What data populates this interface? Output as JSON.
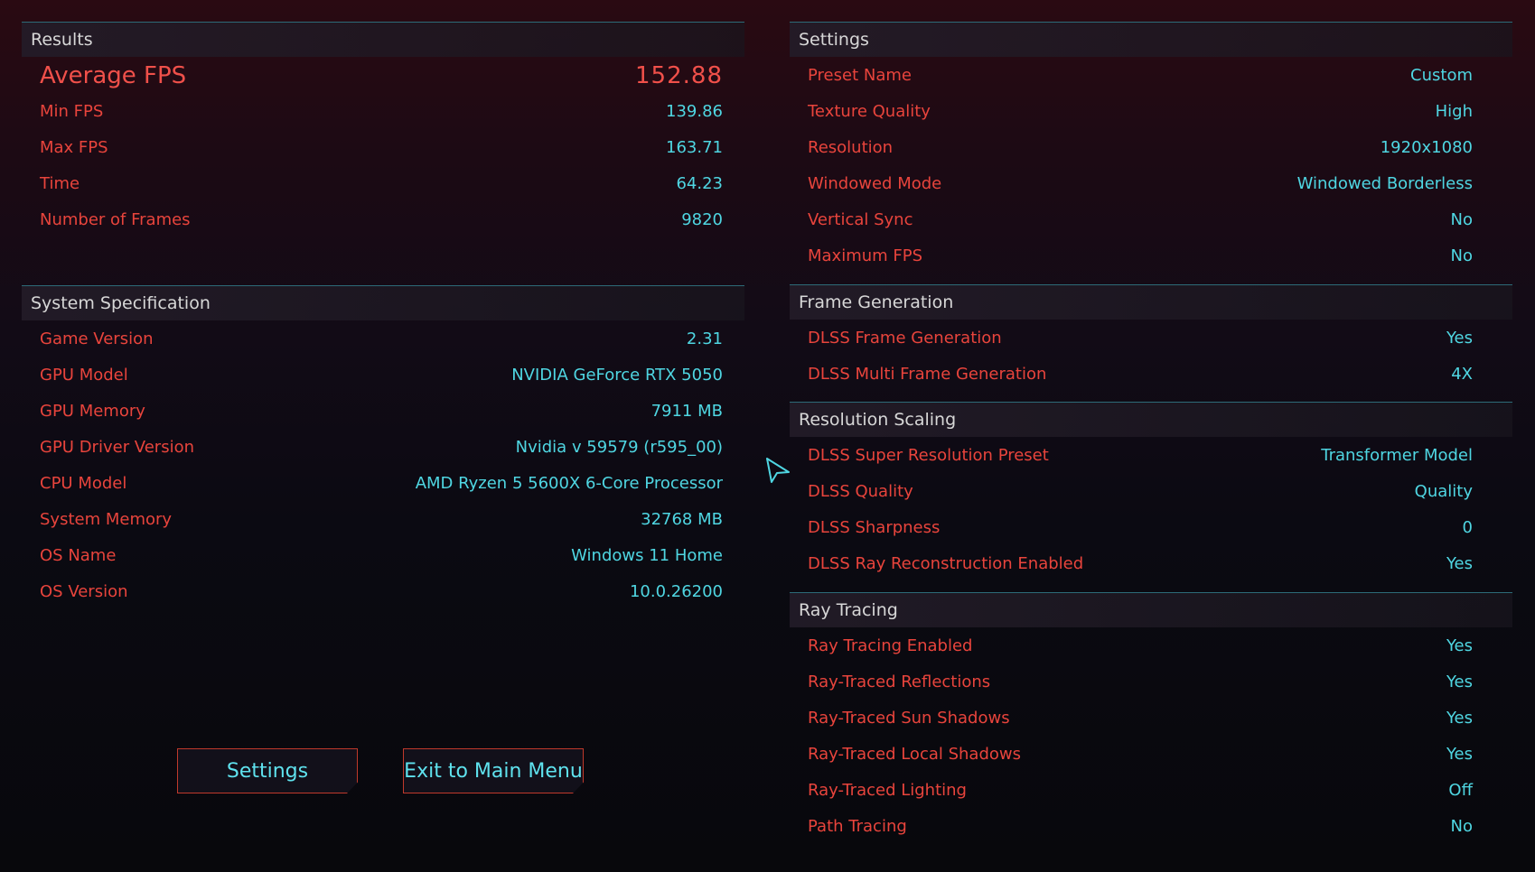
{
  "results": {
    "header": "Results",
    "average": {
      "label": "Average FPS",
      "value": "152.88"
    },
    "rows": [
      {
        "label": "Min FPS",
        "value": "139.86"
      },
      {
        "label": "Max FPS",
        "value": "163.71"
      },
      {
        "label": "Time",
        "value": "64.23"
      },
      {
        "label": "Number of Frames",
        "value": "9820"
      }
    ]
  },
  "system": {
    "header": "System Specification",
    "rows": [
      {
        "label": "Game Version",
        "value": "2.31"
      },
      {
        "label": "GPU Model",
        "value": "NVIDIA GeForce RTX 5050"
      },
      {
        "label": "GPU Memory",
        "value": "7911 MB"
      },
      {
        "label": "GPU Driver Version",
        "value": "Nvidia v 59579 (r595_00)"
      },
      {
        "label": "CPU Model",
        "value": "AMD Ryzen 5 5600X 6-Core Processor"
      },
      {
        "label": "System Memory",
        "value": "32768 MB"
      },
      {
        "label": "OS Name",
        "value": "Windows 11 Home"
      },
      {
        "label": "OS Version",
        "value": "10.0.26200"
      }
    ]
  },
  "buttons": {
    "settings": "Settings",
    "exit": "Exit to Main Menu"
  },
  "settings": {
    "header": "Settings",
    "rows": [
      {
        "label": "Preset Name",
        "value": "Custom"
      },
      {
        "label": "Texture Quality",
        "value": "High"
      },
      {
        "label": "Resolution",
        "value": "1920x1080"
      },
      {
        "label": "Windowed Mode",
        "value": "Windowed Borderless"
      },
      {
        "label": "Vertical Sync",
        "value": "No"
      },
      {
        "label": "Maximum FPS",
        "value": "No"
      }
    ]
  },
  "frame_generation": {
    "header": "Frame Generation",
    "rows": [
      {
        "label": "DLSS Frame Generation",
        "value": "Yes"
      },
      {
        "label": "DLSS Multi Frame Generation",
        "value": "4X"
      }
    ]
  },
  "resolution_scaling": {
    "header": "Resolution Scaling",
    "rows": [
      {
        "label": "DLSS Super Resolution Preset",
        "value": "Transformer Model"
      },
      {
        "label": "DLSS Quality",
        "value": "Quality"
      },
      {
        "label": "DLSS Sharpness",
        "value": "0"
      },
      {
        "label": "DLSS Ray Reconstruction Enabled",
        "value": "Yes"
      }
    ]
  },
  "ray_tracing": {
    "header": "Ray Tracing",
    "rows": [
      {
        "label": "Ray Tracing Enabled",
        "value": "Yes"
      },
      {
        "label": "Ray-Traced Reflections",
        "value": "Yes"
      },
      {
        "label": "Ray-Traced Sun Shadows",
        "value": "Yes"
      },
      {
        "label": "Ray-Traced Local Shadows",
        "value": "Yes"
      },
      {
        "label": "Ray-Traced Lighting",
        "value": "Off"
      },
      {
        "label": "Path Tracing",
        "value": "No"
      }
    ]
  },
  "colors": {
    "label": "#e8443c",
    "value": "#4fd6e2",
    "divider": "#2d6b78",
    "button_border": "#c0392b"
  },
  "icons": {
    "cursor": "mouse-pointer-icon"
  }
}
